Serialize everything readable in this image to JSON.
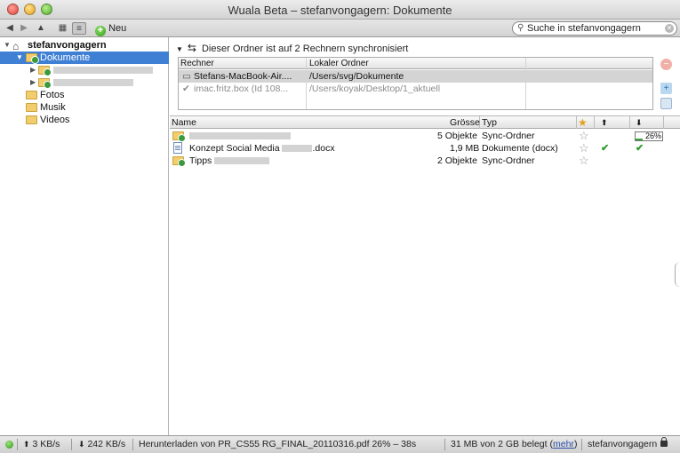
{
  "window": {
    "title": "Wuala Beta – stefanvongagern: Dokumente"
  },
  "toolbar": {
    "back_icon": "left-triangle",
    "forward_icon": "right-triangle",
    "up_icon": "up-triangle",
    "grid_icon": "grid",
    "list_icon": "list",
    "new_label": "Neu",
    "search_placeholder": "Suche in stefanvongagern",
    "search_value": "Suche in stefanvongagern"
  },
  "sidebar": {
    "root_label": "stefanvongagern",
    "items": [
      {
        "label": "Dokumente"
      },
      {
        "label": ""
      },
      {
        "label": ""
      },
      {
        "label": "Fotos"
      },
      {
        "label": "Musik"
      },
      {
        "label": "Videos"
      }
    ]
  },
  "sync": {
    "heading": "Dieser Ordner ist auf 2 Rechnern synchronisiert",
    "columns": [
      "Rechner",
      "Lokaler Ordner"
    ],
    "rows": [
      {
        "computer": "Stefans-MacBook-Air....",
        "folder": "/Users/svg/Dokumente"
      },
      {
        "computer": "imac.fritz.box (Id 108...",
        "folder": "/Users/koyak/Desktop/1_aktuell"
      }
    ]
  },
  "files": {
    "columns": {
      "name": "Name",
      "size": "Grösse",
      "type": "Typ"
    },
    "rows": [
      {
        "name": "",
        "size": "5 Objekte",
        "type": "Sync-Ordner",
        "progress_text": "26%",
        "progress": 0.26
      },
      {
        "name_prefix": "Konzept Social Media ",
        "name_suffix": ".docx",
        "size": "1,9 MB",
        "type": "Dokumente (docx)"
      },
      {
        "name": "Tipps",
        "size": "2 Objekte",
        "type": "Sync-Ordner"
      }
    ]
  },
  "status": {
    "upload": "3 KB/s",
    "download": "242 KB/s",
    "activity": "Herunterladen von PR_CS55 RG_FINAL_20110316.pdf 26% – 38s",
    "storage": "31 MB von 2 GB belegt",
    "more_link": "mehr",
    "user": "stefanvongagern"
  },
  "colors": {
    "selection": "#3f7fd4",
    "online": "#2c9418",
    "check": "#2f9a2f"
  }
}
